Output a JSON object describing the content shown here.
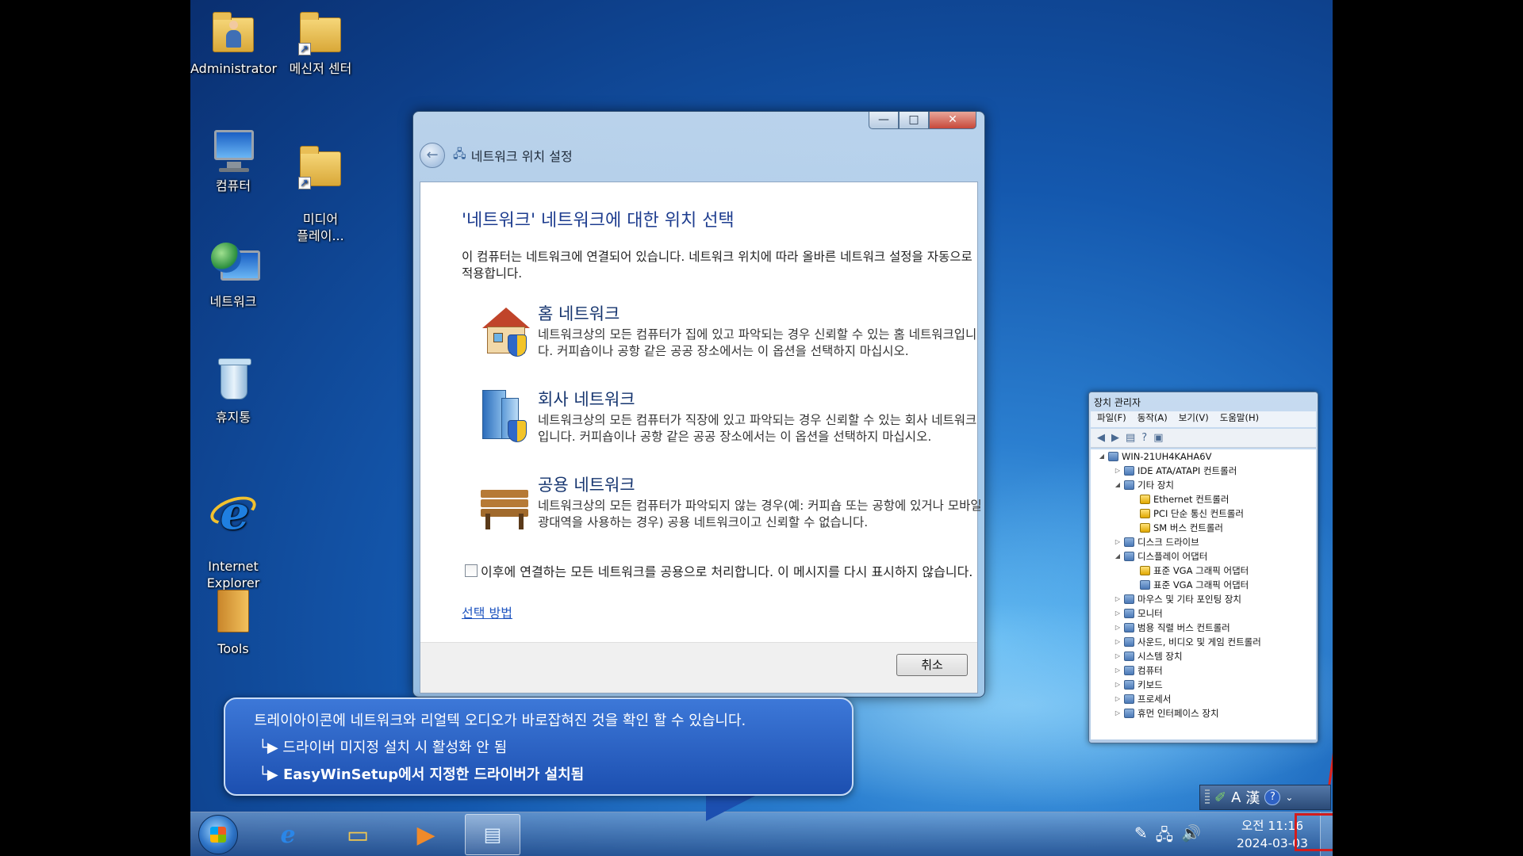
{
  "desktop": {
    "icons": [
      {
        "label": "Administrator"
      },
      {
        "label": "메신저 센터"
      },
      {
        "label": "컴퓨터"
      },
      {
        "label": "미디어\n플레이..."
      },
      {
        "label": "네트워크"
      },
      {
        "label": "휴지통"
      },
      {
        "label": "Internet\nExplorer"
      },
      {
        "label": "Tools"
      }
    ]
  },
  "dialog": {
    "nav_title": "네트워크 위치 설정",
    "heading": "'네트워크' 네트워크에 대한 위치 선택",
    "description": "이 컴퓨터는 네트워크에 연결되어 있습니다. 네트워크 위치에 따라 올바른 네트워크 설정을 자동으로 적용합니다.",
    "options": [
      {
        "title": "홈 네트워크",
        "desc": "네트워크상의 모든 컴퓨터가 집에 있고 파악되는 경우 신뢰할 수 있는 홈 네트워크입니다. 커피숍이나 공항 같은 공공 장소에서는 이 옵션을 선택하지 마십시오.",
        "icon": "house-icon"
      },
      {
        "title": "회사 네트워크",
        "desc": "네트워크상의 모든 컴퓨터가 직장에 있고 파악되는 경우 신뢰할 수 있는 회사 네트워크입니다. 커피숍이나 공항 같은 공공 장소에서는 이 옵션을 선택하지 마십시오.",
        "icon": "office-building-icon"
      },
      {
        "title": "공용 네트워크",
        "desc": "네트워크상의 모든 컴퓨터가 파악되지 않는 경우(예: 커피숍 또는 공항에 있거나 모바일 광대역을 사용하는 경우) 공용 네트워크이고 신뢰할 수 없습니다.",
        "icon": "bench-icon"
      }
    ],
    "checkbox_label": "이후에 연결하는 모든 네트워크를 공용으로 처리합니다. 이 메시지를 다시 표시하지 않습니다.",
    "help_link": "선택 방법",
    "cancel_label": "취소",
    "caption": {
      "minimize": "—",
      "maximize": "□",
      "close": "✕"
    }
  },
  "device_manager": {
    "title": "장치 관리자",
    "menu": [
      "파일(F)",
      "동작(A)",
      "보기(V)",
      "도움말(H)"
    ],
    "tree": [
      {
        "label": "WIN-21UH4KAHA6V",
        "indent": 0,
        "toggle": "◢",
        "warn": false
      },
      {
        "label": "IDE ATA/ATAPI 컨트롤러",
        "indent": 1,
        "toggle": "▷",
        "warn": false
      },
      {
        "label": "기타 장치",
        "indent": 1,
        "toggle": "◢",
        "warn": false
      },
      {
        "label": "Ethernet 컨트롤러",
        "indent": 2,
        "toggle": "",
        "warn": true
      },
      {
        "label": "PCI 단순 통신 컨트롤러",
        "indent": 2,
        "toggle": "",
        "warn": true
      },
      {
        "label": "SM 버스 컨트롤러",
        "indent": 2,
        "toggle": "",
        "warn": true
      },
      {
        "label": "디스크 드라이브",
        "indent": 1,
        "toggle": "▷",
        "warn": false
      },
      {
        "label": "디스플레이 어댑터",
        "indent": 1,
        "toggle": "◢",
        "warn": false
      },
      {
        "label": "표준 VGA 그래픽 어댑터",
        "indent": 2,
        "toggle": "",
        "warn": true
      },
      {
        "label": "표준 VGA 그래픽 어댑터",
        "indent": 2,
        "toggle": "",
        "warn": false
      },
      {
        "label": "마우스 및 기타 포인팅 장치",
        "indent": 1,
        "toggle": "▷",
        "warn": false
      },
      {
        "label": "모니터",
        "indent": 1,
        "toggle": "▷",
        "warn": false
      },
      {
        "label": "범용 직렬 버스 컨트롤러",
        "indent": 1,
        "toggle": "▷",
        "warn": false
      },
      {
        "label": "사운드, 비디오 및 게임 컨트롤러",
        "indent": 1,
        "toggle": "▷",
        "warn": false
      },
      {
        "label": "시스템 장치",
        "indent": 1,
        "toggle": "▷",
        "warn": false
      },
      {
        "label": "컴퓨터",
        "indent": 1,
        "toggle": "▷",
        "warn": false
      },
      {
        "label": "키보드",
        "indent": 1,
        "toggle": "▷",
        "warn": false
      },
      {
        "label": "프로세서",
        "indent": 1,
        "toggle": "▷",
        "warn": false
      },
      {
        "label": "휴먼 인터페이스 장치",
        "indent": 1,
        "toggle": "▷",
        "warn": false
      }
    ]
  },
  "annotation": {
    "line1": "트레이아이콘에 네트워크와 리얼텍 오디오가 바로잡혀진 것을 확인 할 수 있습니다.",
    "line2": "└▶ 드라이버 미지정 설치 시 활성화 안 됨",
    "line3": "└▶ EasyWinSetup에서 지정한 드라이버가 설치됨"
  },
  "taskbar": {
    "time": "오전 11:16",
    "date": "2024-03-03"
  },
  "langbar": {
    "mode_a": "A",
    "mode_han": "漢",
    "help": "?"
  },
  "colors": {
    "accent": "#1e3d8f",
    "annotation_red": "#e0221c",
    "bubble": "#2c63c6"
  }
}
